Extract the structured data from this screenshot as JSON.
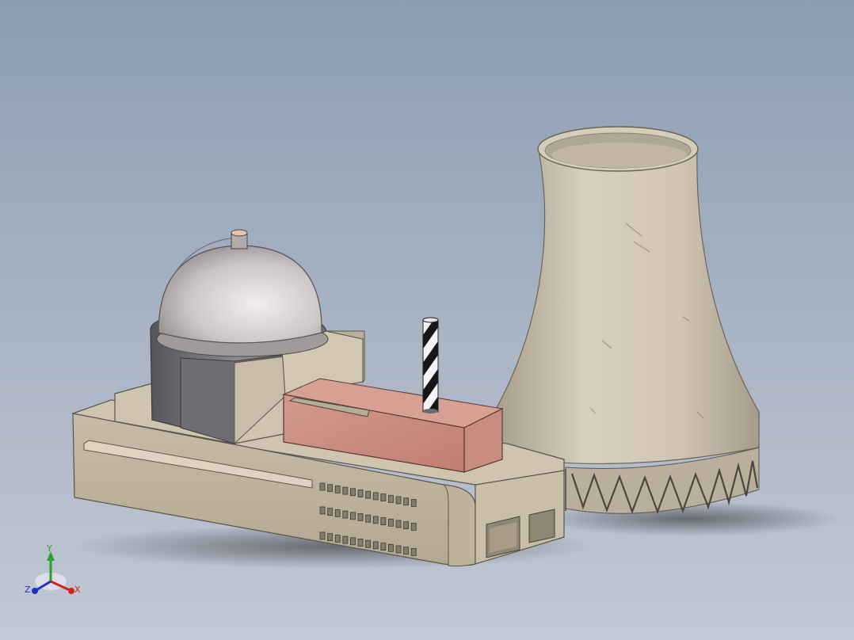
{
  "viewport": {
    "background_top": "#8c9db1",
    "background_bottom": "#c2c8d4"
  },
  "scene": {
    "objects": [
      "reactor-dome",
      "reactor-building",
      "turbine-hall",
      "chimney-stack",
      "cooling-tower"
    ],
    "colors": {
      "concrete": "#cbbfaa",
      "dome": "#c9c3c3",
      "brick": "#c98b80",
      "steel_dark": "#6e6e73"
    }
  },
  "triad": {
    "x_label": "X",
    "y_label": "Y",
    "z_label": "Z",
    "x_color": "#d0241c",
    "y_color": "#2aa02a",
    "z_color": "#2030c8"
  }
}
